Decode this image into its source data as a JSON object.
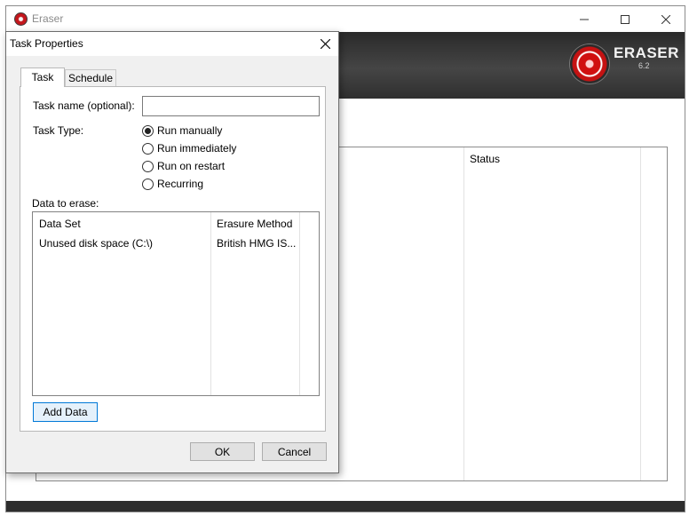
{
  "main_window": {
    "title": "Eraser",
    "logo_text": "ERASER",
    "logo_version": "6.2",
    "task_list": {
      "columns": [
        "Status"
      ]
    }
  },
  "dialog": {
    "title": "Task Properties",
    "tabs": [
      {
        "label": "Task",
        "selected": true
      },
      {
        "label": "Schedule",
        "selected": false
      }
    ],
    "task_name": {
      "label": "Task name (optional):",
      "value": ""
    },
    "task_type": {
      "label": "Task Type:",
      "options": [
        {
          "label": "Run manually",
          "selected": true
        },
        {
          "label": "Run immediately",
          "selected": false
        },
        {
          "label": "Run on restart",
          "selected": false
        },
        {
          "label": "Recurring",
          "selected": false
        }
      ]
    },
    "data_to_erase": {
      "label": "Data to erase:",
      "columns": [
        "Data Set",
        "Erasure Method"
      ],
      "rows": [
        [
          "Unused disk space (C:\\)",
          "British HMG IS..."
        ]
      ]
    },
    "add_data_label": "Add Data",
    "ok_label": "OK",
    "cancel_label": "Cancel"
  },
  "colors": {
    "accent_blue": "#0078d7",
    "banner_dark": "#3a3a3a",
    "logo_red": "#c4161c"
  },
  "icons": [
    "app-icon",
    "minimize-icon",
    "maximize-icon",
    "close-icon",
    "eraser-logo-icon"
  ]
}
